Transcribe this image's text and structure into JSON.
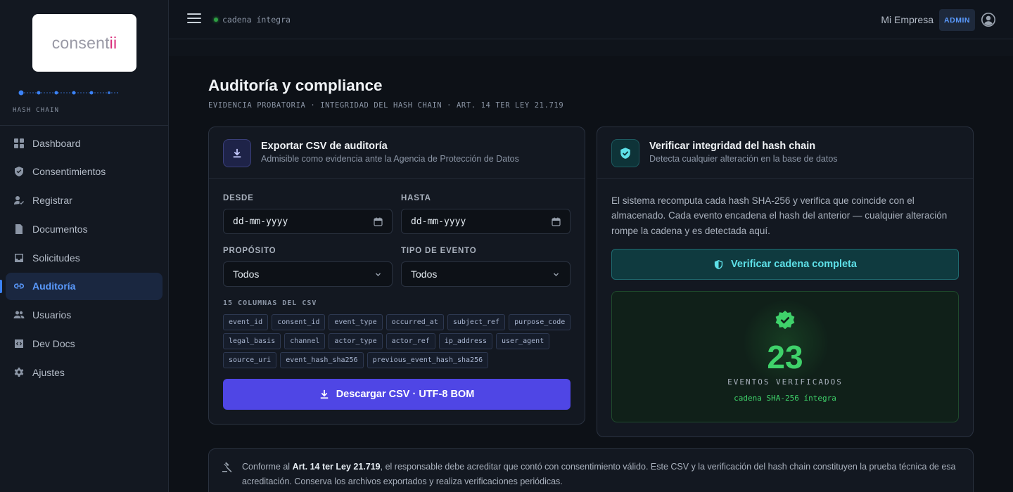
{
  "brand": {
    "logo_text": "consent",
    "logo_accent": "ii",
    "chain_caption": "HASH CHAIN"
  },
  "sidebar": {
    "items": [
      {
        "label": "Dashboard",
        "icon": "grid-icon"
      },
      {
        "label": "Consentimientos",
        "icon": "shield-check-icon"
      },
      {
        "label": "Registrar",
        "icon": "user-check-icon"
      },
      {
        "label": "Documentos",
        "icon": "document-icon"
      },
      {
        "label": "Solicitudes",
        "icon": "inbox-icon"
      },
      {
        "label": "Auditoría",
        "icon": "link-icon",
        "active": true
      },
      {
        "label": "Usuarios",
        "icon": "users-icon"
      },
      {
        "label": "Dev Docs",
        "icon": "code-icon"
      },
      {
        "label": "Ajustes",
        "icon": "gear-icon"
      }
    ]
  },
  "topbar": {
    "status_text": "cadena íntegra",
    "company": "Mi Empresa",
    "role_badge": "ADMIN"
  },
  "page": {
    "title": "Auditoría y compliance",
    "subtitle": "EVIDENCIA PROBATORIA · INTEGRIDAD DEL HASH CHAIN · ART. 14 TER LEY 21.719"
  },
  "export_card": {
    "title": "Exportar CSV de auditoría",
    "subtitle": "Admisible como evidencia ante la Agencia de Protección de Datos",
    "from_label": "DESDE",
    "from_value": "dd-mm-yyyy",
    "to_label": "HASTA",
    "to_value": "dd-mm-yyyy",
    "purpose_label": "PROPÓSITO",
    "purpose_value": "Todos",
    "event_type_label": "TIPO DE EVENTO",
    "event_type_value": "Todos",
    "columns_label": "15 COLUMNAS DEL CSV",
    "columns": [
      "event_id",
      "consent_id",
      "event_type",
      "occurred_at",
      "subject_ref",
      "purpose_code",
      "legal_basis",
      "channel",
      "actor_type",
      "actor_ref",
      "ip_address",
      "user_agent",
      "source_uri",
      "event_hash_sha256",
      "previous_event_hash_sha256"
    ],
    "download_label": "Descargar CSV · UTF-8 BOM"
  },
  "verify_card": {
    "title": "Verificar integridad del hash chain",
    "subtitle": "Detecta cualquier alteración en la base de datos",
    "description": "El sistema recomputa cada hash SHA-256 y verifica que coincide con el almacenado. Cada evento encadena el hash del anterior — cualquier alteración rompe la cadena y es detectada aquí.",
    "button_label": "Verificar cadena completa",
    "count": "23",
    "count_label": "EVENTOS VERIFICADOS",
    "count_status": "cadena SHA-256 íntegra"
  },
  "notice": {
    "prefix": "Conforme al ",
    "law": "Art. 14 ter Ley 21.719",
    "body": ", el responsable debe acreditar que contó con consentimiento válido. Este CSV y la verificación del hash chain constituyen la prueba técnica de esa acreditación. Conserva los archivos exportados y realiza verificaciones periódicas."
  },
  "colors": {
    "primary": "#4f46e5",
    "accent_blue": "#5b9bff",
    "success": "#3fd16a",
    "teal": "#5ee0e8"
  }
}
